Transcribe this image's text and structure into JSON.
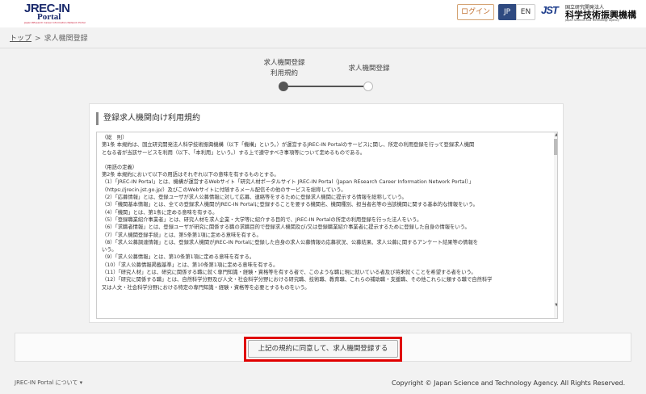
{
  "header": {
    "logo_brand": "JREC-IN",
    "logo_sub": "Portal",
    "logo_tagline": "Japan REsearch Career Information Network Portal",
    "login_label": "ログイン",
    "lang_jp": "JP",
    "lang_en": "EN",
    "jst_mark": "JST",
    "jst_small": "国立研究開発法人",
    "jst_big": "科学技術振興機構",
    "jst_en": "Japan Science and Technology Agency"
  },
  "breadcrumb": {
    "top": "トップ",
    "separator": ">",
    "current": "求人機関登録"
  },
  "steps": [
    {
      "label_line1": "求人機関登録",
      "label_line2": "利用規約",
      "state": "active"
    },
    {
      "label_line1": "求人機関登録",
      "state": "inactive"
    }
  ],
  "terms": {
    "title": "登録求人機関向け利用規約",
    "lines": [
      "（総　則）",
      "第1条 本規約は、国立研究開発法人科学技術振興機構（以下「機構」という。）が運営するJREC-IN Portalのサービスに関し、所定の利用登録を行って登録求人機関",
      "となる者が当該サービスを利用（以下、「本利用」という。）する上で遵守すべき事項等について定めるものである。",
      "",
      "（用語の定義）",
      "第2条 本規約において以下の用語はそれぞれ以下の意味を有するものとする。",
      "（1）「JREC-IN Portal」とは、機構が運営するWebサイト「研究人材ポータルサイト JREC-IN Portal（Japan REsearch Career Information Network Portal）」",
      "（https://jrecin.jst.go.jp/）及びこのWebサイトに付随するメール配信その他のサービスを総称していう。",
      "（2）「応募情報」とは、登録ユーザが求人公募情報に対して応募、連絡等をするために登録求人機関に提示する情報を総称していう。",
      "（3）「機関基本情報」とは、全ての登録求人機関がJREC-IN Portalに登録することを要する機関名、機関種別、担当者名等の当該機関に関する基本的な情報をいう。",
      "（4）「機関」とは、第1条に定める意味を有する。",
      "（5）「登録職業紹介事業者」とは、研究人材を求人企業・大学等に紹介する目的で、JREC-IN Portalの所定の利用登録を行った法人をいう。",
      "（6）「求職者情報」とは、登録ユーザが研究に関係する職の求職目的で登録求人機関及び/又は登録職業紹介事業者に提示するために登録した自身の情報をいう。",
      "（7）「求人機関登録手続」とは、第5条第1項に定める意味を有する。",
      "（8）「求人公募調達情報」とは、登録求人機関がJREC-IN Portalに登録した自身の求人公募情報の応募状況、公募結果、求人公募に関するアンケート結果等の情報を",
      "いう。",
      "（9）「求人公募情報」とは、第10条第1項に定める意味を有する。",
      "（10）「求人公募情報掲載基準」とは、第10条第1項に定める意味を有する。",
      "（11）「研究人材」とは、研究に関係する職に就く専門知識・経験・資格等を有する者で、このような職に現に就いている者及び将来就くことを希望する者をいう。",
      "（12）「研究に関係する職」とは、自然科学分野及び人文・社会科学分野における研究職、技術職、教育職、これらの補助職・支援職、その他これらに類する職で自然科学",
      "又は人文・社会科学分野における特定の専門知識・経験・資格等を必要とするものをいう。"
    ]
  },
  "agree_button": "上記の規約に同意して、求人機関登録する",
  "footer": {
    "about_link": "JREC-IN Portal について ▾",
    "copyright": "Copyright © Japan Science and Technology Agency. All Rights Reserved."
  },
  "colors": {
    "highlight": "#e00000",
    "lang_active": "#2f4a80",
    "login_border": "#d4a373"
  }
}
